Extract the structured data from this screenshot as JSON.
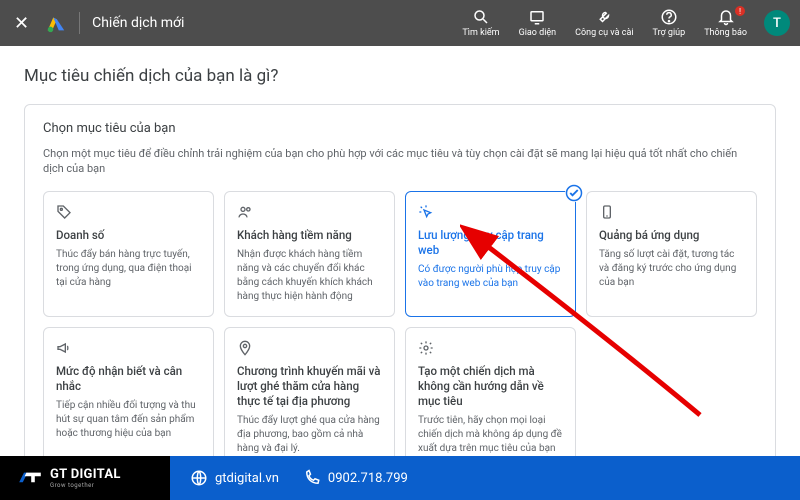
{
  "topbar": {
    "title": "Chiến dịch mới",
    "items": [
      {
        "label": "Tìm kiếm"
      },
      {
        "label": "Giao diện"
      },
      {
        "label": "Công cụ và cài"
      },
      {
        "label": "Trợ giúp"
      },
      {
        "label": "Thông báo"
      }
    ],
    "avatar_letter": "T"
  },
  "page": {
    "title": "Mục tiêu chiến dịch của bạn là gì?",
    "card_title": "Chọn mục tiêu của bạn",
    "card_sub": "Chọn một mục tiêu để điều chỉnh trải nghiệm của bạn cho phù hợp với các mục tiêu và tùy chọn cài đặt sẽ mang lại hiệu quả tốt nhất cho chiến dịch của bạn"
  },
  "objectives": [
    {
      "title": "Doanh số",
      "desc": "Thúc đẩy bán hàng trực tuyến, trong ứng dụng, qua điện thoại tại cửa hàng",
      "selected": false
    },
    {
      "title": "Khách hàng tiềm năng",
      "desc": "Nhận được khách hàng tiềm năng và các chuyển đổi khác bằng cách khuyến khích khách hàng thực hiện hành động",
      "selected": false
    },
    {
      "title": "Lưu lượng truy cập trang web",
      "desc": "Có được người phù hợp truy cập vào trang web của bạn",
      "selected": true
    },
    {
      "title": "Quảng bá ứng dụng",
      "desc": "Tăng số lượt cài đặt, tương tác và đăng ký trước cho ứng dụng của bạn",
      "selected": false
    },
    {
      "title": "Mức độ nhận biết và cân nhắc",
      "desc": "Tiếp cận nhiều đối tượng và thu hút sự quan tâm đến sản phẩm hoặc thương hiệu của bạn",
      "selected": false
    },
    {
      "title": "Chương trình khuyến mãi và lượt ghé thăm cửa hàng thực tế tại địa phương",
      "desc": "Thúc đẩy lượt ghé qua cửa hàng địa phương, bao gồm cả nhà hàng và đại lý.",
      "selected": false
    },
    {
      "title": "Tạo một chiến dịch mà không cần hướng dẫn về mục tiêu",
      "desc": "Trước tiên, hãy chọn mọi loại chiến dịch mà không áp dụng đề xuất dựa trên mục tiêu của bạn",
      "selected": false
    }
  ],
  "footer": {
    "brand": "GT DIGITAL",
    "tagline": "Grow together",
    "website": "gtdigital.vn",
    "phone": "0902.718.799"
  }
}
